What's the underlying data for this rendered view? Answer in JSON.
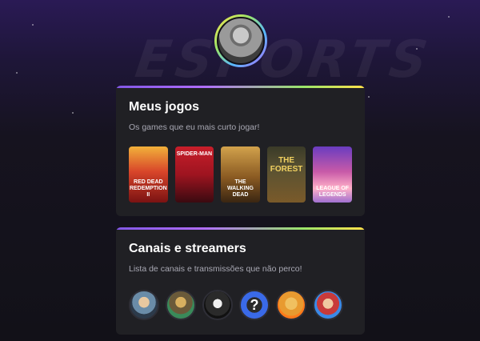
{
  "profile": {
    "avatar_icon": "profile-photo"
  },
  "background": {
    "watermark": "ESPORTS"
  },
  "games_section": {
    "title": "Meus jogos",
    "subtitle": "Os games que eu mais curto jogar!",
    "games": [
      {
        "name": "Red Dead Redemption II",
        "cover_text": "RED DEAD REDEMPTION II"
      },
      {
        "name": "Spider-Man Remastered",
        "cover_text": "SPIDER-MAN"
      },
      {
        "name": "The Walking Dead",
        "cover_text": "THE WALKING DEAD"
      },
      {
        "name": "The Forest",
        "cover_text": "THE FOREST"
      },
      {
        "name": "League of Legends",
        "cover_text": "LEAGUE OF LEGENDS"
      }
    ]
  },
  "streamers_section": {
    "title": "Canais e streamers",
    "subtitle": "Lista de canais e transmissões que não perco!",
    "streamers": [
      {
        "icon": "streamer-avatar-1"
      },
      {
        "icon": "streamer-avatar-2"
      },
      {
        "icon": "streamer-avatar-3"
      },
      {
        "icon": "streamer-avatar-4",
        "glyph": "?"
      },
      {
        "icon": "streamer-avatar-5"
      },
      {
        "icon": "streamer-avatar-6"
      }
    ]
  },
  "colors": {
    "accent_gradient": [
      "#8257e5",
      "#b06cff",
      "#9ae56a",
      "#ffe14a"
    ],
    "card_bg": "#202024"
  }
}
